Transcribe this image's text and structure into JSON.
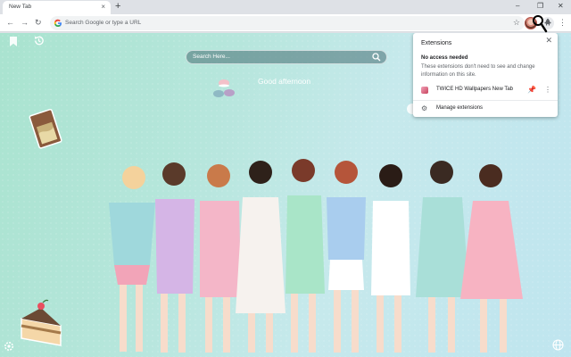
{
  "tab": {
    "title": "New Tab",
    "close_glyph": "×"
  },
  "tabstrip": {
    "new_tab_glyph": "+",
    "minimize_glyph": "–",
    "restore_glyph": "❐",
    "close_glyph": "✕"
  },
  "toolbar": {
    "back_glyph": "←",
    "forward_glyph": "→",
    "reload_glyph": "↻",
    "omnibox_placeholder": "Search Google or type a URL",
    "star_glyph": "☆",
    "menu_glyph": "⋮"
  },
  "page": {
    "search_placeholder": "Search Here...",
    "greeting": "Good afternoon"
  },
  "extensions_popup": {
    "title": "Extensions",
    "close_glyph": "✕",
    "section_title": "No access needed",
    "section_desc": "These extensions don't need to see and change information on this site.",
    "extension_name": "TWICE HD Wallpapers New Tab",
    "pin_glyph": "📌",
    "more_glyph": "⋮",
    "manage_glyph": "⚙",
    "manage_label": "Manage extensions"
  },
  "icons": {
    "tab_close": "close-icon",
    "new_tab": "plus-icon",
    "back": "arrow-left-icon",
    "forward": "arrow-right-icon",
    "reload": "reload-icon",
    "google": "google-g-icon",
    "bookmark_star": "star-icon",
    "extension_avatar": "extension-avatar-icon",
    "extensions": "puzzle-icon",
    "menu": "more-vertical-icon",
    "bookmark": "bookmark-icon",
    "history": "history-icon",
    "search": "search-icon",
    "settings": "settings-icon",
    "globe": "globe-icon",
    "pin": "pin-icon",
    "gear": "gear-icon"
  },
  "colors": {
    "background_start": "#a9e3cf",
    "background_end": "#bfe5ef",
    "accent_blue": "#1a73e8",
    "text_dark": "#202124"
  }
}
